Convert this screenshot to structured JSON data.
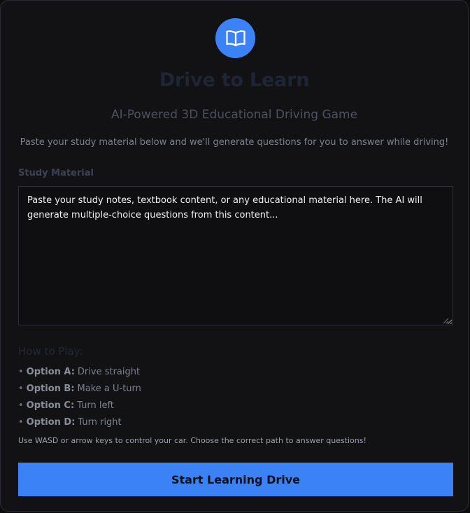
{
  "app": {
    "icon": "open-book-icon",
    "accent_color": "#3b82f6",
    "title": "Drive to Learn",
    "subtitle": "AI-Powered 3D Educational Driving Game",
    "intro": "Paste your study material below and we'll generate questions for you to answer while driving!"
  },
  "study_material": {
    "label": "Study Material",
    "placeholder": "Paste your study notes, textbook content, or any educational material here. The AI will generate multiple-choice questions from this content...",
    "value": ""
  },
  "how_to_play": {
    "title": "How to Play:",
    "options": [
      {
        "key": "Option A:",
        "text": "Drive straight"
      },
      {
        "key": "Option B:",
        "text": "Make a U-turn"
      },
      {
        "key": "Option C:",
        "text": "Turn left"
      },
      {
        "key": "Option D:",
        "text": "Turn right"
      }
    ],
    "hint": "Use WASD or arrow keys to control your car. Choose the correct path to answer questions!"
  },
  "start_button": {
    "label": "Start Learning Drive"
  }
}
